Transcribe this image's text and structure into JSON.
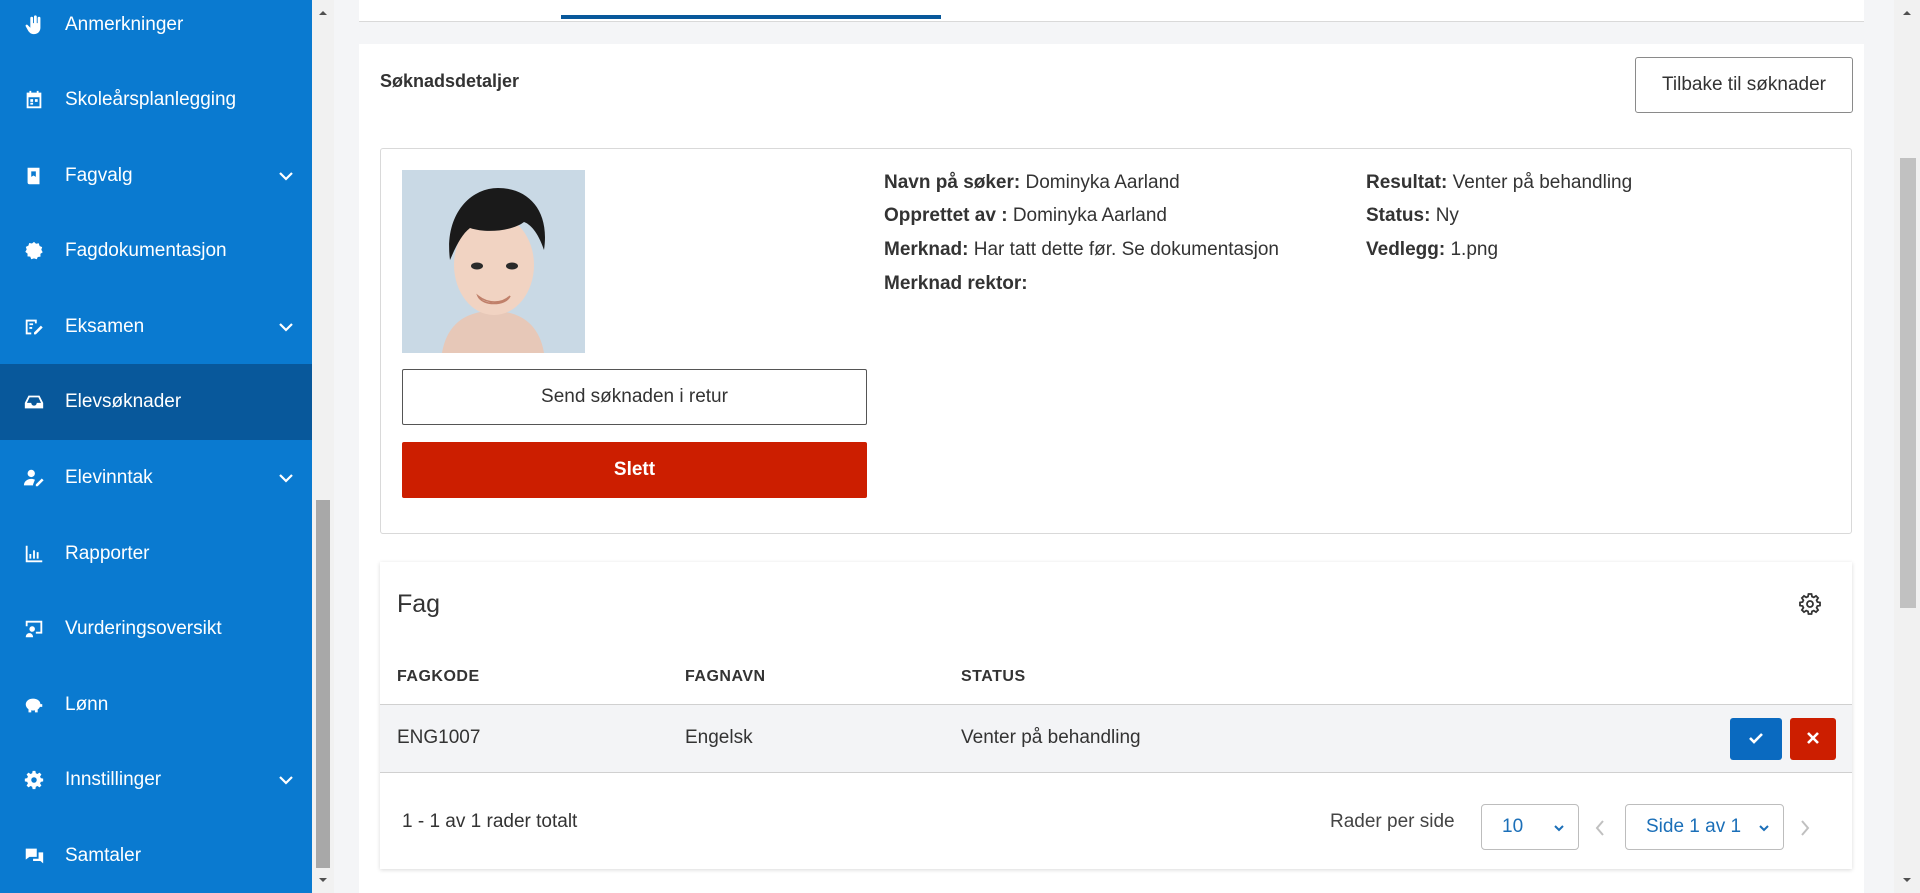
{
  "sidebar": {
    "items": [
      {
        "label": "Anmerkninger",
        "icon": "hand-icon",
        "expandable": false,
        "active": false
      },
      {
        "label": "Skoleårsplanlegging",
        "icon": "calendar-icon",
        "expandable": false,
        "active": false
      },
      {
        "label": "Fagvalg",
        "icon": "book-icon",
        "expandable": true,
        "active": false
      },
      {
        "label": "Fagdokumentasjon",
        "icon": "badge-icon",
        "expandable": false,
        "active": false
      },
      {
        "label": "Eksamen",
        "icon": "exam-icon",
        "expandable": true,
        "active": false
      },
      {
        "label": "Elevsøknader",
        "icon": "inbox-icon",
        "expandable": false,
        "active": true
      },
      {
        "label": "Elevinntak",
        "icon": "user-edit-icon",
        "expandable": true,
        "active": false
      },
      {
        "label": "Rapporter",
        "icon": "bar-chart-icon",
        "expandable": false,
        "active": false
      },
      {
        "label": "Vurderingsoversikt",
        "icon": "chalkboard-icon",
        "expandable": false,
        "active": false
      },
      {
        "label": "Lønn",
        "icon": "piggy-bank-icon",
        "expandable": false,
        "active": false
      },
      {
        "label": "Innstillinger",
        "icon": "gear-icon",
        "expandable": true,
        "active": false
      },
      {
        "label": "Samtaler",
        "icon": "chat-icon",
        "expandable": false,
        "active": false
      }
    ]
  },
  "details": {
    "title": "Søknadsdetaljer",
    "back_button": "Tilbake til søknader",
    "return_button": "Send søknaden i retur",
    "delete_button": "Slett",
    "fields": {
      "navn_label": "Navn på søker:",
      "navn_value": "Dominyka Aarland",
      "opprettet_label": "Opprettet av :",
      "opprettet_value": "Dominyka Aarland",
      "merknad_label": "Merknad:",
      "merknad_value": "Har tatt dette før. Se dokumentasjon",
      "merknad_rektor_label": "Merknad rektor:",
      "merknad_rektor_value": "",
      "resultat_label": "Resultat:",
      "resultat_value": "Venter på behandling",
      "status_label": "Status:",
      "status_value": "Ny",
      "vedlegg_label": "Vedlegg:",
      "vedlegg_value": "1.png"
    }
  },
  "fag": {
    "title": "Fag",
    "columns": [
      "FAGKODE",
      "FAGNAVN",
      "STATUS"
    ],
    "rows": [
      {
        "fagkode": "ENG1007",
        "fagnavn": "Engelsk",
        "status": "Venter på behandling"
      }
    ],
    "footer": {
      "total_text": "1 - 1 av 1 rader totalt",
      "rows_per_page_label": "Rader per side",
      "rows_per_page_value": "10",
      "page_value": "Side 1 av 1"
    }
  },
  "colors": {
    "sidebar": "#0a7ad0",
    "sidebar_active": "#08589b",
    "danger": "#cc1e00",
    "primary": "#0a6ac0"
  }
}
